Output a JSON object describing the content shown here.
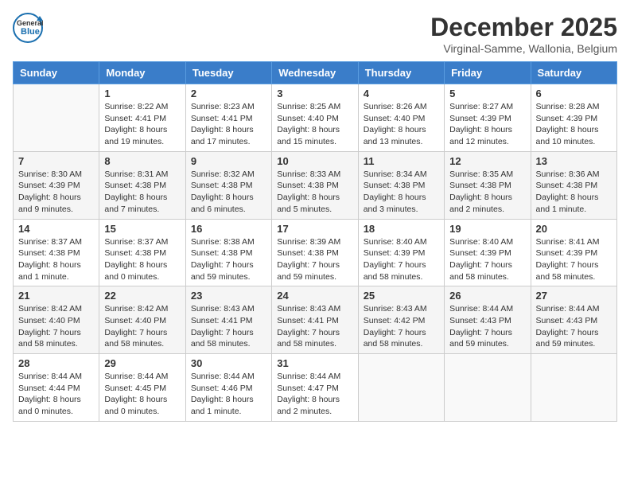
{
  "header": {
    "logo_line1": "General",
    "logo_line2": "Blue",
    "month": "December 2025",
    "location": "Virginal-Samme, Wallonia, Belgium"
  },
  "weekdays": [
    "Sunday",
    "Monday",
    "Tuesday",
    "Wednesday",
    "Thursday",
    "Friday",
    "Saturday"
  ],
  "weeks": [
    [
      {
        "day": "",
        "info": ""
      },
      {
        "day": "1",
        "info": "Sunrise: 8:22 AM\nSunset: 4:41 PM\nDaylight: 8 hours\nand 19 minutes."
      },
      {
        "day": "2",
        "info": "Sunrise: 8:23 AM\nSunset: 4:41 PM\nDaylight: 8 hours\nand 17 minutes."
      },
      {
        "day": "3",
        "info": "Sunrise: 8:25 AM\nSunset: 4:40 PM\nDaylight: 8 hours\nand 15 minutes."
      },
      {
        "day": "4",
        "info": "Sunrise: 8:26 AM\nSunset: 4:40 PM\nDaylight: 8 hours\nand 13 minutes."
      },
      {
        "day": "5",
        "info": "Sunrise: 8:27 AM\nSunset: 4:39 PM\nDaylight: 8 hours\nand 12 minutes."
      },
      {
        "day": "6",
        "info": "Sunrise: 8:28 AM\nSunset: 4:39 PM\nDaylight: 8 hours\nand 10 minutes."
      }
    ],
    [
      {
        "day": "7",
        "info": "Sunrise: 8:30 AM\nSunset: 4:39 PM\nDaylight: 8 hours\nand 9 minutes."
      },
      {
        "day": "8",
        "info": "Sunrise: 8:31 AM\nSunset: 4:38 PM\nDaylight: 8 hours\nand 7 minutes."
      },
      {
        "day": "9",
        "info": "Sunrise: 8:32 AM\nSunset: 4:38 PM\nDaylight: 8 hours\nand 6 minutes."
      },
      {
        "day": "10",
        "info": "Sunrise: 8:33 AM\nSunset: 4:38 PM\nDaylight: 8 hours\nand 5 minutes."
      },
      {
        "day": "11",
        "info": "Sunrise: 8:34 AM\nSunset: 4:38 PM\nDaylight: 8 hours\nand 3 minutes."
      },
      {
        "day": "12",
        "info": "Sunrise: 8:35 AM\nSunset: 4:38 PM\nDaylight: 8 hours\nand 2 minutes."
      },
      {
        "day": "13",
        "info": "Sunrise: 8:36 AM\nSunset: 4:38 PM\nDaylight: 8 hours\nand 1 minute."
      }
    ],
    [
      {
        "day": "14",
        "info": "Sunrise: 8:37 AM\nSunset: 4:38 PM\nDaylight: 8 hours\nand 1 minute."
      },
      {
        "day": "15",
        "info": "Sunrise: 8:37 AM\nSunset: 4:38 PM\nDaylight: 8 hours\nand 0 minutes."
      },
      {
        "day": "16",
        "info": "Sunrise: 8:38 AM\nSunset: 4:38 PM\nDaylight: 7 hours\nand 59 minutes."
      },
      {
        "day": "17",
        "info": "Sunrise: 8:39 AM\nSunset: 4:38 PM\nDaylight: 7 hours\nand 59 minutes."
      },
      {
        "day": "18",
        "info": "Sunrise: 8:40 AM\nSunset: 4:39 PM\nDaylight: 7 hours\nand 58 minutes."
      },
      {
        "day": "19",
        "info": "Sunrise: 8:40 AM\nSunset: 4:39 PM\nDaylight: 7 hours\nand 58 minutes."
      },
      {
        "day": "20",
        "info": "Sunrise: 8:41 AM\nSunset: 4:39 PM\nDaylight: 7 hours\nand 58 minutes."
      }
    ],
    [
      {
        "day": "21",
        "info": "Sunrise: 8:42 AM\nSunset: 4:40 PM\nDaylight: 7 hours\nand 58 minutes."
      },
      {
        "day": "22",
        "info": "Sunrise: 8:42 AM\nSunset: 4:40 PM\nDaylight: 7 hours\nand 58 minutes."
      },
      {
        "day": "23",
        "info": "Sunrise: 8:43 AM\nSunset: 4:41 PM\nDaylight: 7 hours\nand 58 minutes."
      },
      {
        "day": "24",
        "info": "Sunrise: 8:43 AM\nSunset: 4:41 PM\nDaylight: 7 hours\nand 58 minutes."
      },
      {
        "day": "25",
        "info": "Sunrise: 8:43 AM\nSunset: 4:42 PM\nDaylight: 7 hours\nand 58 minutes."
      },
      {
        "day": "26",
        "info": "Sunrise: 8:44 AM\nSunset: 4:43 PM\nDaylight: 7 hours\nand 59 minutes."
      },
      {
        "day": "27",
        "info": "Sunrise: 8:44 AM\nSunset: 4:43 PM\nDaylight: 7 hours\nand 59 minutes."
      }
    ],
    [
      {
        "day": "28",
        "info": "Sunrise: 8:44 AM\nSunset: 4:44 PM\nDaylight: 8 hours\nand 0 minutes."
      },
      {
        "day": "29",
        "info": "Sunrise: 8:44 AM\nSunset: 4:45 PM\nDaylight: 8 hours\nand 0 minutes."
      },
      {
        "day": "30",
        "info": "Sunrise: 8:44 AM\nSunset: 4:46 PM\nDaylight: 8 hours\nand 1 minute."
      },
      {
        "day": "31",
        "info": "Sunrise: 8:44 AM\nSunset: 4:47 PM\nDaylight: 8 hours\nand 2 minutes."
      },
      {
        "day": "",
        "info": ""
      },
      {
        "day": "",
        "info": ""
      },
      {
        "day": "",
        "info": ""
      }
    ]
  ]
}
